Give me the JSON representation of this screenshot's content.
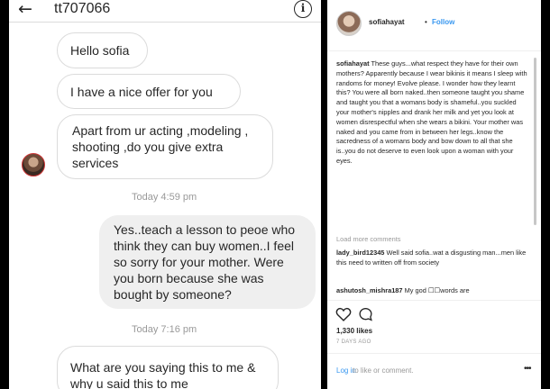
{
  "dm": {
    "username": "tt707066",
    "messages": [
      {
        "text": "Hello sofia",
        "type": "received"
      },
      {
        "text": "I have a nice offer for you",
        "type": "received"
      },
      {
        "text": "Apart from ur acting ,modeling , shooting ,do you give extra services",
        "type": "received"
      },
      {
        "text": "Yes..teach a lesson to peoe who think they can buy women..I feel so sorry for your mother. Were you born because she was bought by someone?",
        "type": "sent"
      },
      {
        "text": "What are you saying this to me & why u said this to me",
        "type": "received"
      }
    ],
    "timestamps": [
      "Today 4:59 pm",
      "Today 7:16 pm"
    ]
  },
  "post": {
    "username": "sofiahayat",
    "dot": "•",
    "follow_label": "Follow",
    "caption_user": "sofiahayat",
    "caption_text": "These guys...what respect they have for their own mothers? Apparently because I wear bikinis it means I sleep with randoms for money! Evolve please. I wonder how they learnt this? You were all born naked..then someone taught you shame and taught you that a womans body is shameful..you suckled your mother's nipples and drank her milk and yet you look at women disrespectful when she wears a bikini. Your mother was naked and you came from in between her legs..know the sacredness of a womans body and bow down to all that she is..you do not deserve to even look upon a woman with your eyes.",
    "load_more": "Load more comments",
    "comments": [
      {
        "user": "lady_bird12345",
        "text": "Well said sofia..wat a disgusting man...men like this need to written off from society"
      },
      {
        "user": "ashutosh_mishra187",
        "text": "My god ☐☐words are"
      }
    ],
    "likes": "1,330 likes",
    "ago": "7 DAYS AGO",
    "login_link": "Log in",
    "login_rest": "to like or comment.",
    "more": "•••"
  },
  "colors": {
    "accent": "#3897f0",
    "text": "#262626",
    "muted": "#999999",
    "sent_bubble": "#efefef"
  }
}
